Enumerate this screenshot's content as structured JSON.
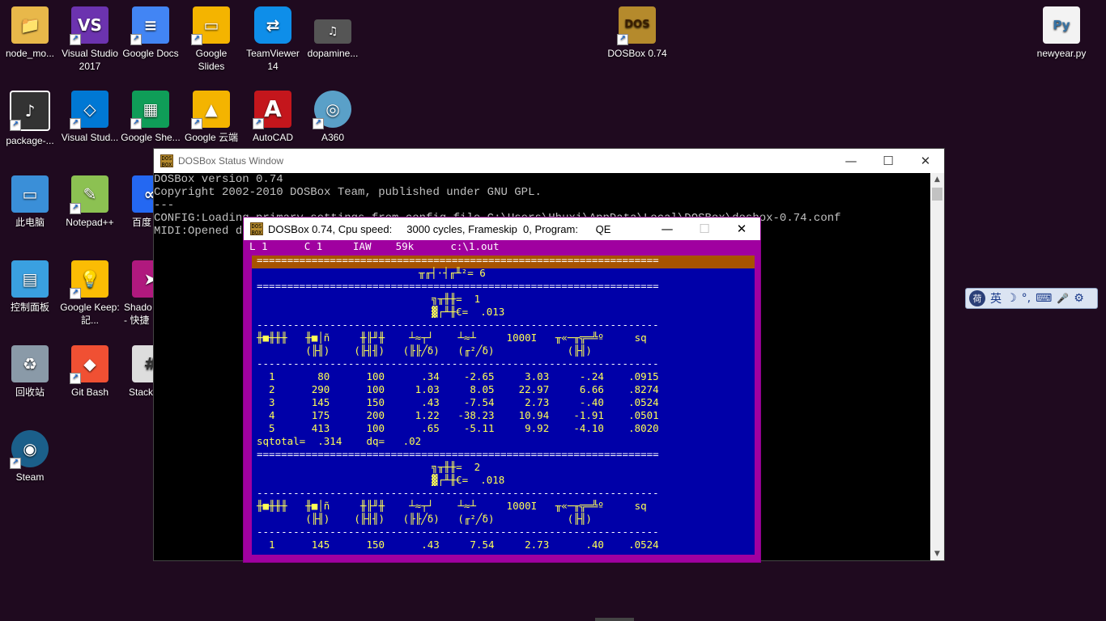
{
  "desktop": {
    "icons": [
      {
        "label": "node_mo...",
        "glyph": "📁",
        "color": "#e8b84a"
      },
      {
        "label": "Visual Studio 2017",
        "glyph": "VS",
        "color": "#6c33af"
      },
      {
        "label": "Google Docs",
        "glyph": "≡",
        "color": "#4285f4"
      },
      {
        "label": "Google Slides",
        "glyph": "▭",
        "color": "#f4b400"
      },
      {
        "label": "TeamViewer 14",
        "glyph": "⇄",
        "color": "#0e8ee9"
      },
      {
        "label": "dopamine...",
        "glyph": "♫",
        "color": "#555555"
      },
      {
        "label": "DOSBox 0.74",
        "glyph": "DOS",
        "color": "#b58a2c"
      },
      {
        "label": "newyear.py",
        "glyph": "Py",
        "color": "#3572a5"
      },
      {
        "label": "package-...",
        "glyph": "♪",
        "color": "#333333"
      },
      {
        "label": "Visual Stud...",
        "glyph": "◇",
        "color": "#0078d4"
      },
      {
        "label": "Google She...",
        "glyph": "▦",
        "color": "#0f9d58"
      },
      {
        "label": "Google 云端",
        "glyph": "▲",
        "color": "#f4b400"
      },
      {
        "label": "AutoCAD",
        "glyph": "A",
        "color": "#c4161c"
      },
      {
        "label": "A360",
        "glyph": "◎",
        "color": "#5aa0c8"
      },
      {
        "label": "此电脑",
        "glyph": "▭",
        "color": "#3a8fd8"
      },
      {
        "label": "Notepad++",
        "glyph": "✎",
        "color": "#8cc152"
      },
      {
        "label": "百度",
        "glyph": "∞",
        "color": "#2468f2"
      },
      {
        "label": "控制面板",
        "glyph": "▤",
        "color": "#3aa0e0"
      },
      {
        "label": "Google Keep: 記...",
        "glyph": "💡",
        "color": "#fbbc04"
      },
      {
        "label": "Shado - 快捷",
        "glyph": "➤",
        "color": "#b0197e"
      },
      {
        "label": "回收站",
        "glyph": "♻",
        "color": "#8a9aa8"
      },
      {
        "label": "Git Bash",
        "glyph": "◆",
        "color": "#f05033"
      },
      {
        "label": "Stack",
        "glyph": "#",
        "color": "#dddddd"
      },
      {
        "label": "Steam",
        "glyph": "◉",
        "color": "#1b5f8a"
      }
    ]
  },
  "status_window": {
    "title": "DOSBox Status Window",
    "lines": [
      "DOSBox version 0.74",
      "Copyright 2002-2010 DOSBox Team, published under GNU GPL.",
      "---",
      "CONFIG:Loading primary settings from config file C:\\Users\\Hhuxi\\AppData\\Local\\DOSBox\\dosbox-0.74.conf",
      "MIDI:Opened de"
    ],
    "minimize": "—",
    "maximize": "☐",
    "close": "✕"
  },
  "dos_window": {
    "title": "DOSBox 0.74, Cpu speed:     3000 cycles, Frameskip  0, Program:      QE",
    "icon_text": "DOS BOX",
    "minimize": "—",
    "maximize": "☐",
    "close": "✕",
    "status_line": "L 1      C 1     IAW    59k      c:\\1.out",
    "sep_double": "==================================================================",
    "sep_single": "------------------------------------------------------------------",
    "heading_count": "╥╓┤·┤╓╨²= 6",
    "group1_label": "╗╥╫╫=  1",
    "group1_value": "▓┌╨╫€=  .013",
    "header_row1": "╫■╫╫╫   ╫■│ñ     ╫╟╜╫    ┴≈┬┘    ┴≈┴     1000I   ╥«─╥╦═╩º     sq",
    "header_row2": "        (╟╢)    (╟╢╢)   (╟╟╱δ)   (╓²╱δ)            (╟╢)",
    "group1_rows": [
      "  1       80      100      .34    -2.65     3.03     -.24    .0915",
      "  2      290      100     1.03     8.05    22.97     6.66    .8274",
      "  3      145      150      .43    -7.54     2.73     -.40    .0524",
      "  4      175      200     1.22   -38.23    10.94    -1.91    .0501",
      "  5      413      100      .65    -5.11     9.92    -4.10    .8020"
    ],
    "sqtotal_line": "sqtotal=  .314    dq=   .02",
    "group2_label": "╗╥╫╫=  2",
    "group2_value": "▓┌╨╫€=  .018",
    "group2_rows": [
      "  1      145      150      .43     7.54     2.73      .40    .0524"
    ]
  },
  "ime": {
    "logo": "荷",
    "lang": "英",
    "moon": "☽",
    "dot": "°,",
    "keyboard": "⌨",
    "mic": "🎤",
    "gear": "⚙"
  }
}
